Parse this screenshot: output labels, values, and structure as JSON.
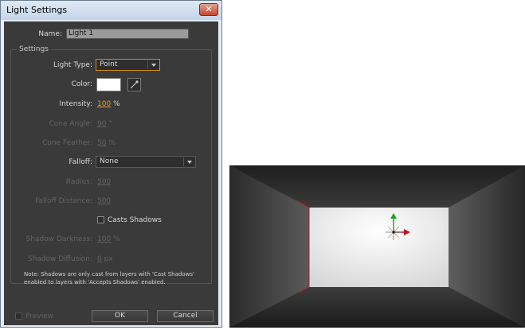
{
  "dialog": {
    "title": "Light Settings",
    "close_glyph": "✕",
    "name_label": "Name:",
    "name_value": "Light 1",
    "settings_group": "Settings",
    "light_type_label": "Light Type:",
    "light_type_value": "Point",
    "color_label": "Color:",
    "color_value": "#ffffff",
    "intensity_label": "Intensity:",
    "intensity_value": "100",
    "intensity_unit": "%",
    "cone_angle_label": "Cone Angle:",
    "cone_angle_value": "90",
    "cone_angle_unit": "°",
    "cone_feather_label": "Cone Feather:",
    "cone_feather_value": "50",
    "cone_feather_unit": "%",
    "falloff_label": "Falloff:",
    "falloff_value": "None",
    "radius_label": "Radius:",
    "radius_value": "500",
    "falloff_distance_label": "Falloff Distance:",
    "falloff_distance_value": "500",
    "casts_shadows_label": "Casts Shadows",
    "shadow_darkness_label": "Shadow Darkness:",
    "shadow_darkness_value": "100",
    "shadow_darkness_unit": "%",
    "shadow_diffusion_label": "Shadow Diffusion:",
    "shadow_diffusion_value": "0",
    "shadow_diffusion_unit": "px",
    "note_line1": "Note: Shadows are only cast from layers with 'Cast Shadows'",
    "note_line2": "enabled to layers with 'Accepts Shadows' enabled.",
    "preview_label": "Preview",
    "ok_label": "OK",
    "cancel_label": "Cancel"
  },
  "colors": {
    "panel": "#3a3a3a",
    "accent_orange": "#e89b20",
    "light_axis_x": "#c0141e",
    "light_axis_y": "#22a020"
  }
}
